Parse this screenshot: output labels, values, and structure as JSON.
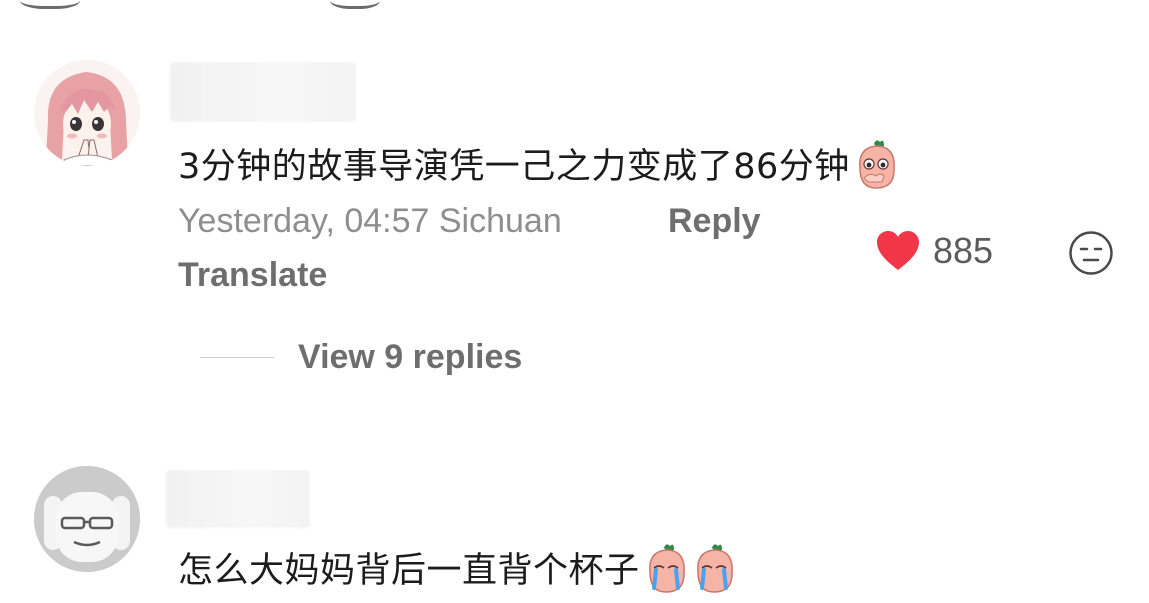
{
  "comments": [
    {
      "avatar_icon": "anime-girl-avatar",
      "text": "3分钟的故事导演凭一己之力变成了86分钟",
      "emoji_icon": "peach-covering-mouth-emoji",
      "timestamp": "Yesterday, 04:57",
      "location": "Sichuan",
      "reply_label": "Reply",
      "translate_label": "Translate",
      "like_icon": "red-heart-icon",
      "like_color": "#f2364a",
      "like_count": "885",
      "dislike_icon": "neutral-face-icon",
      "view_replies_label": "View 9 replies"
    },
    {
      "avatar_icon": "default-gray-avatar",
      "text": "怎么大妈妈背后一直背个杯子",
      "emoji_icons": [
        "peach-crying-emoji",
        "peach-crying-emoji"
      ]
    }
  ]
}
